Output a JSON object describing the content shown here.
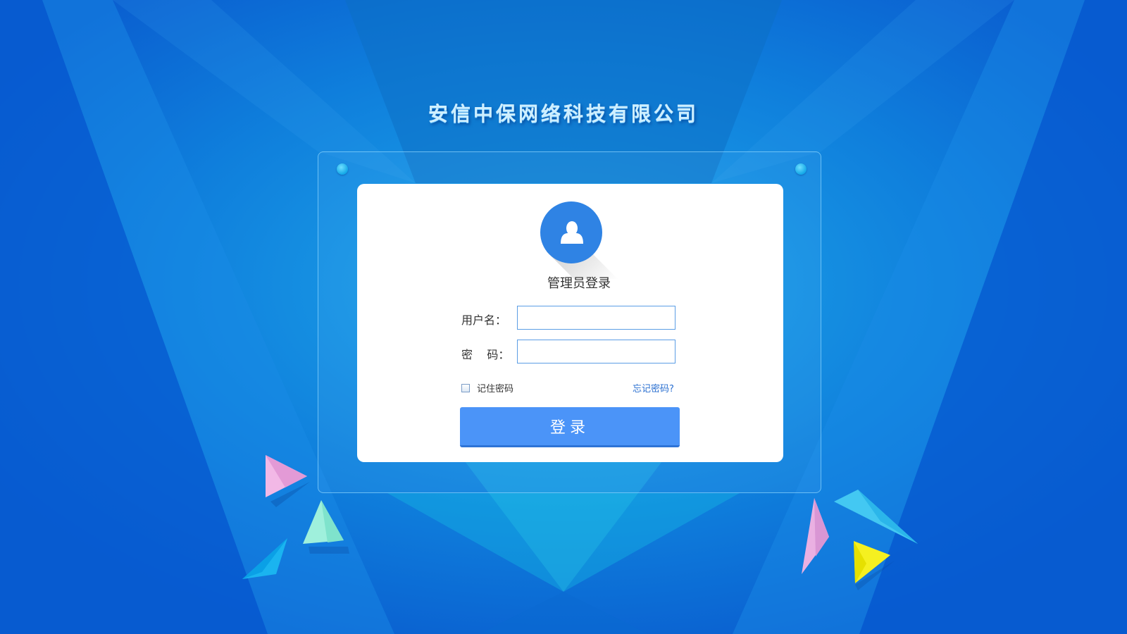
{
  "app": {
    "company_name": "安信中保网络科技有限公司"
  },
  "login": {
    "title": "管理员登录",
    "username_label": "用户名：",
    "username_value": "",
    "password_label": "密    码：",
    "password_value": "",
    "remember_label": "记住密码",
    "remember_checked": false,
    "forgot_link": "忘记密码?",
    "submit_label": "登录"
  },
  "icons": {
    "avatar": "user-icon",
    "decorations": [
      "pink-triangle-icon",
      "mint-triangle-icon",
      "cyan-triangle-icon",
      "yellow-triangle-icon"
    ]
  },
  "colors": {
    "background": "#0a5fd0",
    "accent": "#4b94f8",
    "avatar": "#2f83e4",
    "link": "#2a6fd0",
    "title_text": "#cfefff"
  }
}
